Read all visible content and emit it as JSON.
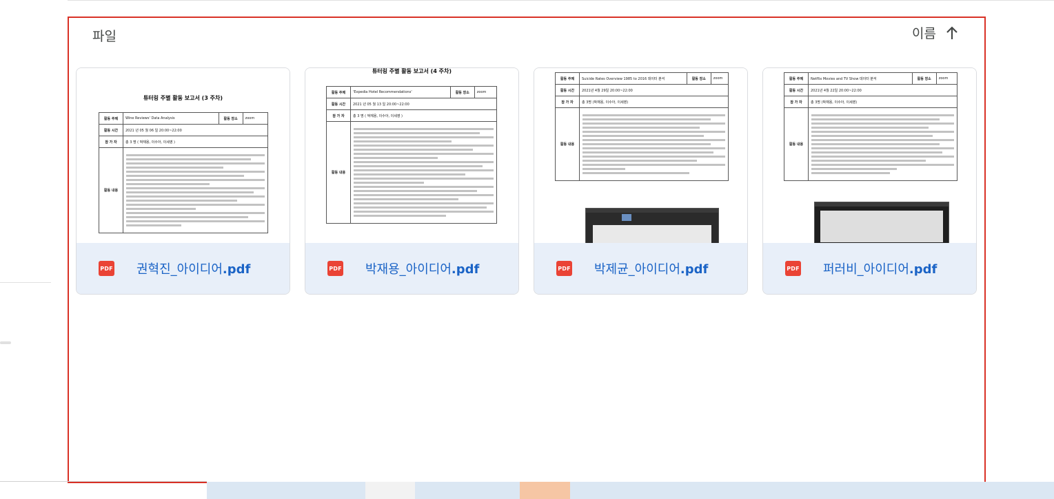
{
  "section": {
    "files_label": "파일",
    "sort_label": "이름"
  },
  "files": [
    {
      "name": "권혁진_아이디어",
      "ext": ".pdf",
      "icon": "PDF",
      "thumb_title": "튜터링 주별 활동 보고서 (3 주차)",
      "rows": [
        [
          "활동 주제",
          "Wine Reviews' Data Analysis",
          "활동 장소",
          "zoom"
        ],
        [
          "활동 시간",
          "2021 년 05 월 06 일 20:00~22:00"
        ],
        [
          "참 가 자",
          "총 3 명 ( 박재용, 이수아, 이세영 )"
        ]
      ],
      "body_label": "활동 내용"
    },
    {
      "name": "박재용_아이디어",
      "ext": ".pdf",
      "icon": "PDF",
      "thumb_title": "튜터링 주별 활동 보고서 (4 주차)",
      "rows": [
        [
          "활동 주제",
          "'Expedia Hotel Recommendations'",
          "활동 장소",
          "zoom"
        ],
        [
          "활동 시간",
          "2021 년 05 월 13 일 20:00~22:00"
        ],
        [
          "참 가 자",
          "총 3 명 ( 박재용, 이수아, 이세영 )"
        ]
      ],
      "body_label": "활동 내용"
    },
    {
      "name": "박제균_아이디어",
      "ext": ".pdf",
      "icon": "PDF",
      "thumb_title": "",
      "rows": [
        [
          "활동 주제",
          "Suicide Rates Overview 1985 to 2016 데이터 분석",
          "활동 장소",
          "zoom"
        ],
        [
          "활동 시간",
          "2021년 4월 29일 20:00~22:00"
        ],
        [
          "참 가 자",
          "총 3명 (박재용, 이수아, 이세영)"
        ]
      ],
      "body_label": "활동 내용"
    },
    {
      "name": "퍼러비_아이디어",
      "ext": ".pdf",
      "icon": "PDF",
      "thumb_title": "",
      "rows": [
        [
          "활동 주제",
          "Netflix Movies and TV Show 데이터 분석",
          "활동 장소",
          "zoom"
        ],
        [
          "활동 시간",
          "2021년 4월 22일 20:00~22:00"
        ],
        [
          "참 가 자",
          "총 3명 (박재용, 이수아, 이세영)"
        ]
      ],
      "body_label": "활동 내용"
    }
  ],
  "colors": {
    "highlight_border": "#d93025",
    "card_footer": "#e8eff9",
    "file_name": "#1a63c6",
    "pdf_icon": "#ea4335"
  },
  "icons": {
    "sort": "arrow-up-icon",
    "file": "pdf-icon"
  }
}
